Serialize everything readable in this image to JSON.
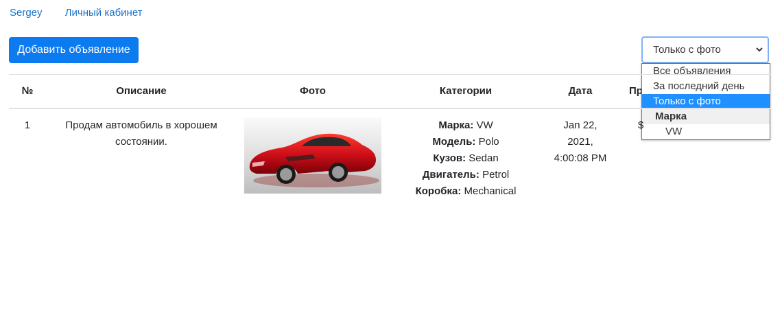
{
  "nav": {
    "user": "Sergey",
    "cabinet": "Личный кабинет"
  },
  "toolbar": {
    "add_label": "Добавить объявление"
  },
  "filter": {
    "selected": "Только с фото",
    "options": [
      "Все объявления",
      "За последний день",
      "Только с фото"
    ],
    "group_label": "Марка",
    "group_options": [
      "VW"
    ]
  },
  "table": {
    "headers": {
      "num": "№",
      "desc": "Описание",
      "photo": "Фото",
      "categories": "Категории",
      "date": "Дата",
      "price": "Пр"
    },
    "row": {
      "num": "1",
      "desc_line1": "Продам автомобиль в хорошем",
      "desc_line2": "состоянии.",
      "cat_make_label": "Марка:",
      "cat_make": "VW",
      "cat_model_label": "Модель:",
      "cat_model": "Polo",
      "cat_body_label": "Кузов:",
      "cat_body": "Sedan",
      "cat_engine_label": "Двигатель:",
      "cat_engine": "Petrol",
      "cat_gear_label": "Коробка:",
      "cat_gear": "Mechanical",
      "date_line1": "Jan 22,",
      "date_line2": "2021,",
      "date_line3": "4:00:08 PM",
      "price_partial": "$"
    }
  }
}
